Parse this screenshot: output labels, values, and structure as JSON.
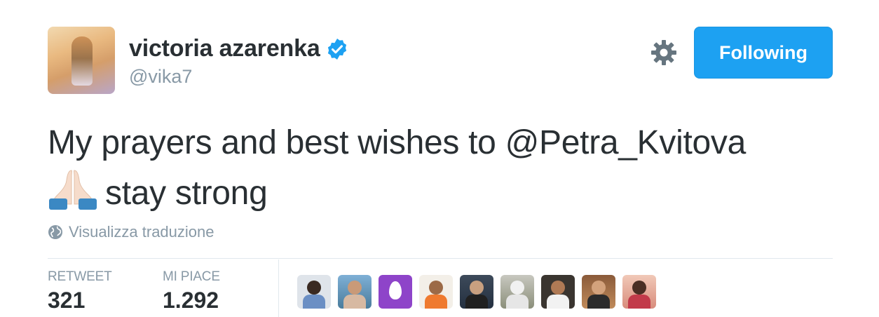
{
  "author": {
    "name": "victoria azarenka",
    "handle": "@vika7",
    "verified": true
  },
  "actions": {
    "follow_label": "Following"
  },
  "tweet": {
    "line1": "My prayers and best wishes to @Petra_Kvitova",
    "line2_emoji": "folded-hands-emoji",
    "line2_text": "stay strong"
  },
  "translate_label": "Visualizza traduzione",
  "stats": {
    "retweet_label": "RETWEET",
    "retweet_count": "321",
    "likes_label": "MI PIACE",
    "likes_count": "1.292"
  },
  "colors": {
    "accent": "#1da1f2",
    "text": "#292f33",
    "muted": "#8899a6",
    "divider": "#e1e8ed"
  },
  "icons": {
    "verified": "verified-badge-icon",
    "settings": "gear-icon",
    "translate": "globe-icon"
  },
  "liker_count_shown": 9
}
